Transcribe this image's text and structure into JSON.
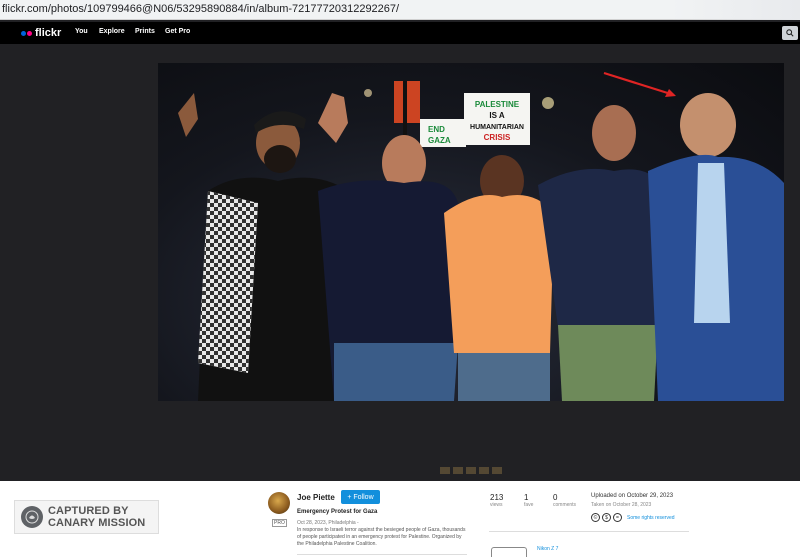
{
  "browser": {
    "url": "flickr.com/photos/109799466@N06/53295890884/in/album-72177720312292267/"
  },
  "nav": {
    "logo": "flickr",
    "items": [
      "You",
      "Explore",
      "Prints",
      "Get Pro"
    ],
    "colors": {
      "blue": "#0063dc",
      "pink": "#ff0084"
    }
  },
  "photo": {
    "signs": {
      "sign1": "PALESTINE IS A HUMANITARIAN CRISIS",
      "sign2": "END GAZA"
    }
  },
  "watermark": {
    "line1": "CAPTURED BY",
    "line2": "CANARY MISSION"
  },
  "author": {
    "name": "Joe Piette",
    "badge": "PRO",
    "follow_label": "+ Follow"
  },
  "photo_info": {
    "title": "Emergency Protest for Gaza",
    "date_location": "Oct 28, 2023, Philadelphia -",
    "description": "In response to Israeli terror against the besieged people of Gaza, thousands of people participated in an emergency protest for Palestine. Organized by the Philadelphia Palestine Coalition."
  },
  "stats": [
    {
      "value": "213",
      "label": "views"
    },
    {
      "value": "1",
      "label": "fave"
    },
    {
      "value": "0",
      "label": "comments"
    }
  ],
  "meta": {
    "uploaded": "Uploaded on October 29, 2023",
    "taken": "Taken on October 28, 2023",
    "rights": "Some rights reserved",
    "cc_icons": [
      "©",
      "$",
      "="
    ],
    "camera": "Nikon Z 7"
  }
}
